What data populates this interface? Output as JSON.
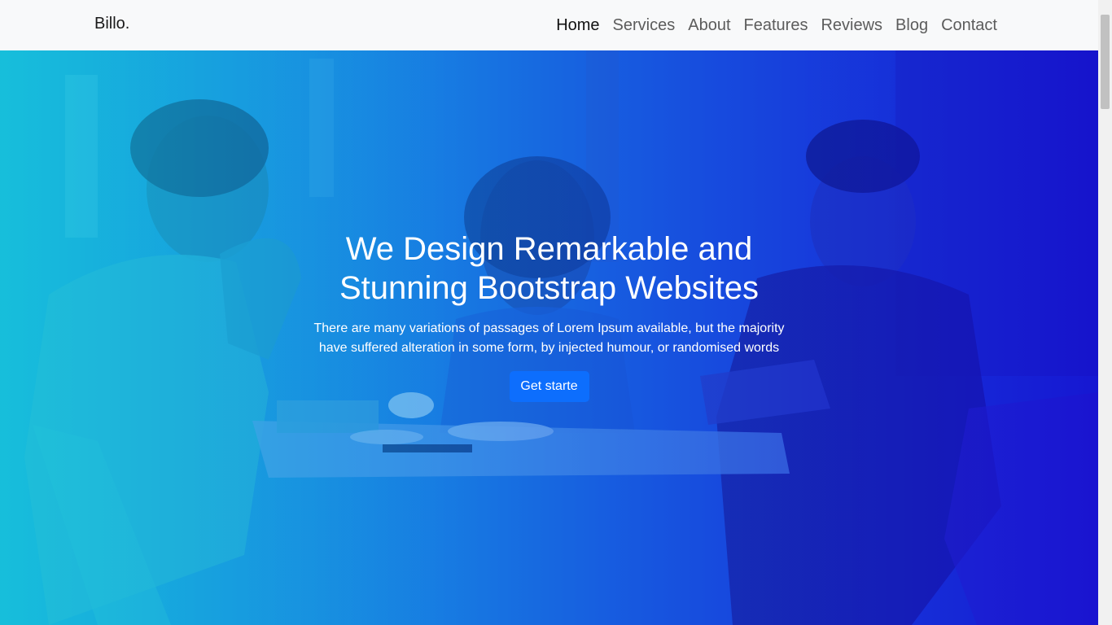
{
  "navbar": {
    "brand": "Billo.",
    "links": [
      {
        "label": "Home",
        "active": true
      },
      {
        "label": "Services",
        "active": false
      },
      {
        "label": "About",
        "active": false
      },
      {
        "label": "Features",
        "active": false
      },
      {
        "label": "Reviews",
        "active": false
      },
      {
        "label": "Blog",
        "active": false
      },
      {
        "label": "Contact",
        "active": false
      }
    ]
  },
  "hero": {
    "title": "We Design Remarkable and Stunning Bootstrap Websites",
    "text": "There are many variations of passages of Lorem Ipsum available, but the majority have suffered alteration in some form, by injected humour, or randomised words",
    "cta_label": "Get starte",
    "background_image": "people-at-cafe-table-photo",
    "overlay_colors": [
      "#17c3d9",
      "#1a10d0"
    ]
  },
  "colors": {
    "accent": "#0d6efd",
    "navbar_bg": "#f8f9fa"
  }
}
